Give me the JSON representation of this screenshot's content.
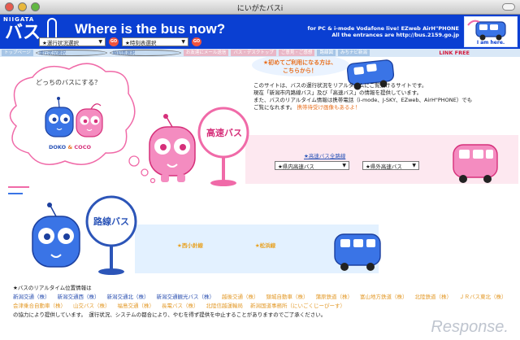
{
  "window": {
    "title": "にいがたバスi"
  },
  "banner": {
    "logo_small": "NIIGATA",
    "logo_big": "バス",
    "headline": "Where is the bus now?",
    "carriers_line1": "for PC & i-mode Vodafone live! EZweb AirH\"PHONE",
    "carriers_line2": "All the entrances are http://bus.2159.go.jp",
    "iamhere": "I am here.",
    "link_free": "LINK FREE"
  },
  "menu": {
    "items": [
      "トップページ",
      "運行状況選択",
      "時刻表選択",
      "お友達にメール送信",
      "バス・デスクトップ",
      "ご意見・ご感想",
      "路線図",
      "みちナビ新潟"
    ]
  },
  "toolbar": {
    "select1": "★運行状況選択",
    "select2": "★時刻表選択",
    "go": "GO"
  },
  "notice": {
    "line1": "★初めてご利用になる方は、",
    "line2": "こちらから！"
  },
  "intro": {
    "line1": "このサイトは、バスの運行状況をリアルタイムにご覧頂けるサイトです。",
    "line2": "現在「新潟市内路線バス」及び「高速バス」の情報を提供しています。",
    "line3": "また、バスのリアルタイム情報は携帯電話（i-mode、J-SKY、EZweb、AirH\"PHONE）でも",
    "line4_plain": "ご覧になれます。",
    "line4_em": "携帯待受け画像もあるよ！"
  },
  "cloud": {
    "question": "どっちのバスにする？",
    "doko": "DOKO",
    "amp": "&",
    "coco": "COCO"
  },
  "kousoku": {
    "sign": "高速バス",
    "section_title": "★高速バス全路線",
    "select_in": "★県内高速バス",
    "select_out": "★県外高速バス"
  },
  "rosen": {
    "sign": "路線バス",
    "route1": "★西小針線",
    "route2": "★松浜線"
  },
  "footer": {
    "title": "★バスのリアルタイム位置情報は",
    "companies": [
      {
        "name": "新潟交通（株）",
        "color": "blue"
      },
      {
        "name": "新潟交通西（株）",
        "color": "blue"
      },
      {
        "name": "新潟交通北（株）",
        "color": "blue"
      },
      {
        "name": "新潟交通観光バス（株）",
        "color": "blue"
      },
      {
        "name": "越後交通（株）",
        "color": "orange"
      },
      {
        "name": "頸城自動車（株）",
        "color": "orange"
      },
      {
        "name": "蒲原鉄道（株）",
        "color": "orange"
      },
      {
        "name": "富山地方鉄道（株）",
        "color": "orange"
      },
      {
        "name": "北陸鉄道（株）",
        "color": "orange"
      },
      {
        "name": "ＪＲバス東北（株）",
        "color": "orange"
      },
      {
        "name": "会津乗合自動車（株）",
        "color": "orange"
      },
      {
        "name": "山交バス（株）",
        "color": "orange"
      },
      {
        "name": "福島交通（株）",
        "color": "orange"
      },
      {
        "name": "長電バス（株）",
        "color": "orange"
      },
      {
        "name": "北陸信越運輸局",
        "color": "orange"
      },
      {
        "name": "新潟国道事務所（にいごくじーぴーす）",
        "color": "orange"
      }
    ],
    "cooperation": "の協力により提供しています。　運行状況、システムの都合により、やむを得ず提供を中止することがありますのでご了承ください。"
  },
  "watermark": "Response.",
  "colors": {
    "brand_blue": "#0a3fd2",
    "pink": "#f06aa8",
    "orange": "#e86f1e"
  }
}
